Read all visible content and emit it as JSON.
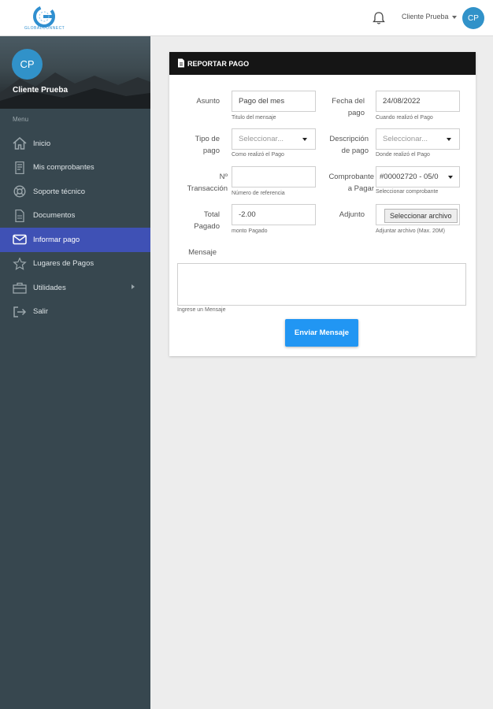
{
  "brand": {
    "logo_text": "GLOBALCONNECT",
    "accent": "#2f8fd0"
  },
  "topbar": {
    "user_name": "Cliente Prueba",
    "avatar_initials": "CP",
    "bell_icon": "bell-icon"
  },
  "sidebar": {
    "avatar_initials": "CP",
    "user_name": "Cliente Prueba",
    "menu_title": "Menu",
    "items": [
      {
        "label": "Inicio",
        "icon": "home-icon"
      },
      {
        "label": "Mis comprobantes",
        "icon": "document-icon"
      },
      {
        "label": "Soporte técnico",
        "icon": "lifebuoy-icon"
      },
      {
        "label": "Documentos",
        "icon": "file-icon"
      },
      {
        "label": "Informar pago",
        "icon": "envelope-icon",
        "active": true
      },
      {
        "label": "Lugares de Pagos",
        "icon": "star-icon"
      },
      {
        "label": "Utilidades",
        "icon": "toolbox-icon",
        "has_submenu": true
      },
      {
        "label": "Salir",
        "icon": "logout-icon"
      }
    ]
  },
  "form": {
    "title": "REPORTAR PAGO",
    "asunto": {
      "label": "Asunto",
      "value": "Pago del mes",
      "help": "Titulo del mensaje"
    },
    "fecha": {
      "label": "Fecha del pago",
      "value": "24/08/2022",
      "help": "Cuando realizó el Pago"
    },
    "tipo_pago": {
      "label": "Tipo de pago",
      "value": "Seleccionar...",
      "help": "Como realizó el Pago"
    },
    "descripcion": {
      "label": "Descripción de pago",
      "value": "Seleccionar...",
      "help": "Donde realizó el Pago"
    },
    "transaccion": {
      "label": "Nº Transacción",
      "value": "",
      "help": "Número de referencia"
    },
    "comprobante": {
      "label": "Comprobante a Pagar",
      "value": "#00002720 - 05/0",
      "help": "Seleccionar comprobante"
    },
    "total": {
      "label": "Total Pagado",
      "value": "-2.00",
      "help": "monto Pagado"
    },
    "adjunto": {
      "label": "Adjunto",
      "button": "Seleccionar archivo",
      "help": "Adjuntar archivo (Max. 20M)"
    },
    "mensaje": {
      "label": "Mensaje",
      "value": "",
      "help": "Ingrese un Mensaje"
    },
    "submit": "Enviar Mensaje"
  }
}
